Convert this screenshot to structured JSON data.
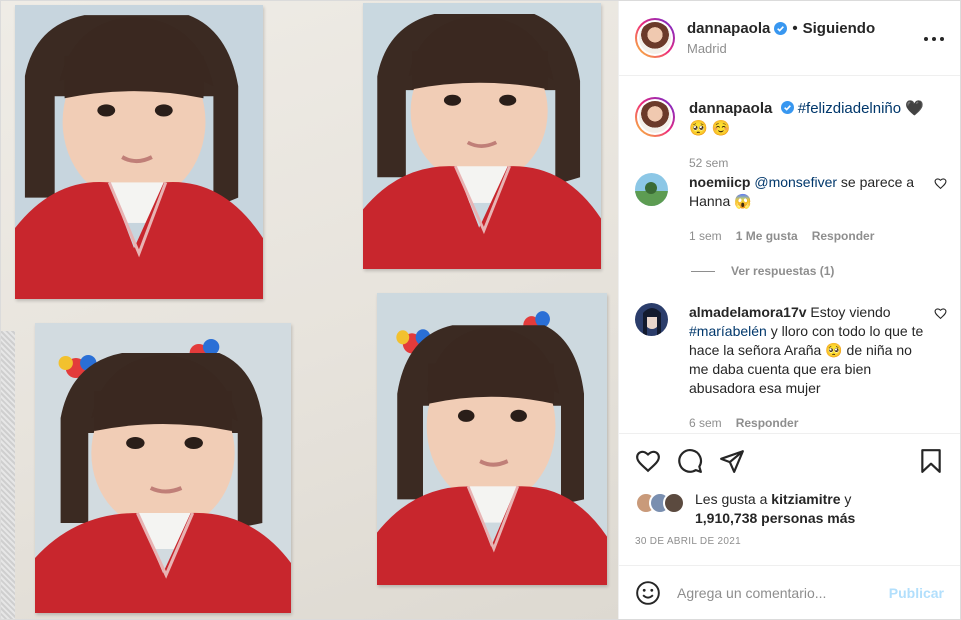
{
  "post": {
    "username": "dannapaola",
    "following_label": "Siguiendo",
    "location": "Madrid",
    "caption": {
      "username": "dannapaola",
      "hashtag": "#felizdiadelniño",
      "emojis": "🖤 🥺 ☺️",
      "time": "52 sem"
    }
  },
  "comments": [
    {
      "username": "noemiicp",
      "mention": "@monsefiver",
      "text": " se parece a Hanna 😱",
      "time": "1 sem",
      "likes": "1 Me gusta",
      "reply_label": "Responder",
      "view_replies": "Ver respuestas (1)"
    },
    {
      "username": "almadelamora17v",
      "text_before": " Estoy viendo ",
      "hashtag": "#maríabelén",
      "text_after": " y lloro con todo lo que te hace la señora Araña 🥺 de niña no me daba cuenta que era bien abusadora esa mujer",
      "time": "6 sem",
      "reply_label": "Responder"
    }
  ],
  "likes": {
    "prefix": "Les gusta a ",
    "user": "kitziamitre",
    "conj": " y",
    "count": "1,910,738 personas más"
  },
  "date": "30 DE ABRIL DE 2021",
  "add_comment": {
    "placeholder": "Agrega un comentario...",
    "publish_label": "Publicar"
  },
  "colors": {
    "link": "#00376b",
    "muted": "#8e8e8e",
    "publish_disabled": "#b2dffc",
    "verified": "#3897f0"
  },
  "icons": [
    "more-options-icon",
    "verified-icon",
    "heart-icon",
    "comment-icon",
    "share-icon",
    "save-icon",
    "emoji-icon"
  ]
}
